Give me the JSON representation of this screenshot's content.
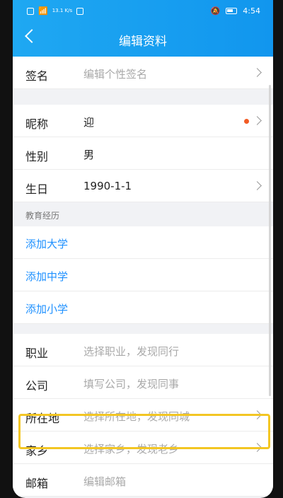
{
  "status_bar": {
    "speed": "13.1 K/s",
    "time": "4:54"
  },
  "header": {
    "title": "编辑资料"
  },
  "rows": {
    "signature": {
      "label": "签名",
      "placeholder": "编辑个性签名"
    },
    "nickname": {
      "label": "昵称",
      "value": "迎"
    },
    "gender": {
      "label": "性别",
      "value": "男"
    },
    "birthday": {
      "label": "生日",
      "value": "1990-1-1"
    },
    "education": {
      "section": "教育经历",
      "add_university": "添加大学",
      "add_middle": "添加中学",
      "add_primary": "添加小学"
    },
    "job": {
      "label": "职业",
      "placeholder": "选择职业，发现同行"
    },
    "company": {
      "label": "公司",
      "placeholder": "填写公司，发现同事"
    },
    "location": {
      "label": "所在地",
      "placeholder": "选择所在地，发现同城"
    },
    "hometown": {
      "label": "家乡",
      "placeholder": "选择家乡，发现老乡"
    },
    "hometown_next": {
      "label": "邮箱",
      "placeholder": "编辑邮箱"
    }
  },
  "colors": {
    "accent": "#1196ee",
    "link": "#1e90ff",
    "dot": "#f25b24",
    "highlight": "#f3c623"
  }
}
